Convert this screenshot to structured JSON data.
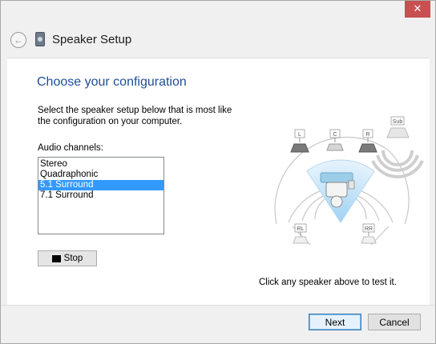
{
  "window": {
    "close_glyph": "✕"
  },
  "header": {
    "title": "Speaker Setup",
    "back_glyph": "←"
  },
  "content": {
    "heading": "Choose your configuration",
    "instruction": "Select the speaker setup below that is most like the configuration on your computer.",
    "channels_label": "Audio channels:",
    "channels": [
      {
        "label": "Stereo",
        "selected": false
      },
      {
        "label": "Quadraphonic",
        "selected": false
      },
      {
        "label": "5.1 Surround",
        "selected": true
      },
      {
        "label": "7.1 Surround",
        "selected": false
      }
    ],
    "stop_button": "Stop",
    "hint": "Click any speaker above to test it."
  },
  "speakers": {
    "front_left": "L",
    "center": "C",
    "front_right": "R",
    "subwoofer": "Sub",
    "rear_left": "RL",
    "rear_right": "RR"
  },
  "footer": {
    "next": "Next",
    "cancel": "Cancel"
  }
}
